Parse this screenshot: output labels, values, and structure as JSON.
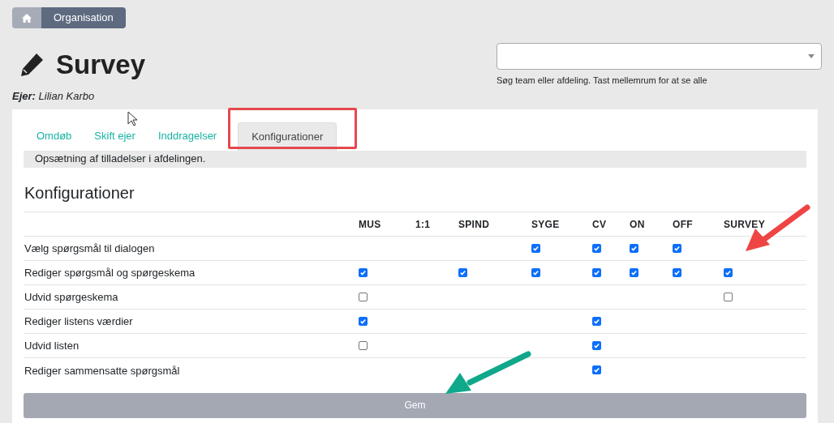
{
  "breadcrumb": [
    {
      "kind": "home"
    },
    {
      "kind": "text",
      "label": "Organisation"
    }
  ],
  "title": "Survey",
  "owner": {
    "label": "Ejer:",
    "name": "Lilian Karbo"
  },
  "search": {
    "hint": "Søg team eller afdeling. Tast mellemrum for at se alle"
  },
  "tabs": [
    {
      "label": "Omdøb",
      "selected": false
    },
    {
      "label": "Skift ejer",
      "selected": false
    },
    {
      "label": "Inddragelser",
      "selected": false
    },
    {
      "label": "Konfigurationer",
      "selected": true
    }
  ],
  "tab_description": "Opsætning af tilladelser i afdelingen.",
  "section_title": "Konfigurationer",
  "table": {
    "columns": [
      "MUS",
      "1:1",
      "SPIND",
      "SYGE",
      "CV",
      "ON",
      "OFF",
      "SURVEY"
    ],
    "rows": [
      {
        "label": "Vælg spørgsmål til dialogen",
        "cells": [
          null,
          null,
          null,
          true,
          true,
          true,
          true,
          null
        ]
      },
      {
        "label": "Rediger spørgsmål og spørgeskema",
        "cells": [
          true,
          null,
          true,
          true,
          true,
          true,
          true,
          true
        ]
      },
      {
        "label": "Udvid spørgeskema",
        "cells": [
          false,
          null,
          null,
          null,
          null,
          null,
          null,
          false
        ]
      },
      {
        "label": "Rediger listens værdier",
        "cells": [
          true,
          null,
          null,
          null,
          true,
          null,
          null,
          null
        ]
      },
      {
        "label": "Udvid listen",
        "cells": [
          false,
          null,
          null,
          null,
          true,
          null,
          null,
          null
        ]
      },
      {
        "label": "Rediger sammensatte spørgsmål",
        "cells": [
          null,
          null,
          null,
          null,
          true,
          null,
          null,
          null
        ]
      }
    ]
  },
  "save_button": "Gem"
}
